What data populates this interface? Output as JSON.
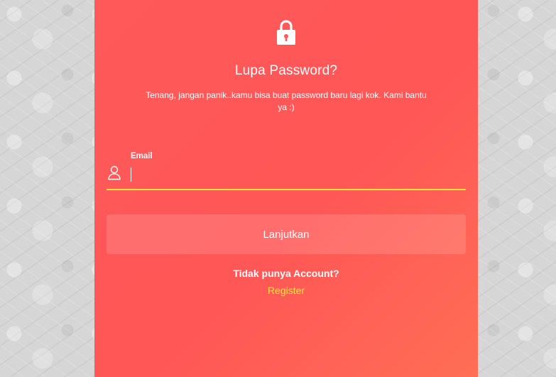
{
  "page": {
    "title": "Lupa Password?",
    "subtitle": "Tenang, jangan panik..kamu bisa buat password baru lagi kok. Kami bantu ya :)"
  },
  "form": {
    "email_label": "Email",
    "email_value": "",
    "email_icon": "user-icon",
    "submit_label": "Lanjutkan"
  },
  "footer": {
    "no_account_text": "Tidak punya Account?",
    "register_label": "Register"
  },
  "colors": {
    "card_background": "#ff5959",
    "underline_accent": "#f1e23a",
    "link_accent": "#f5e63a",
    "page_background": "#d6d6d6"
  },
  "icons": {
    "header": "lock-icon",
    "email": "user-icon"
  }
}
